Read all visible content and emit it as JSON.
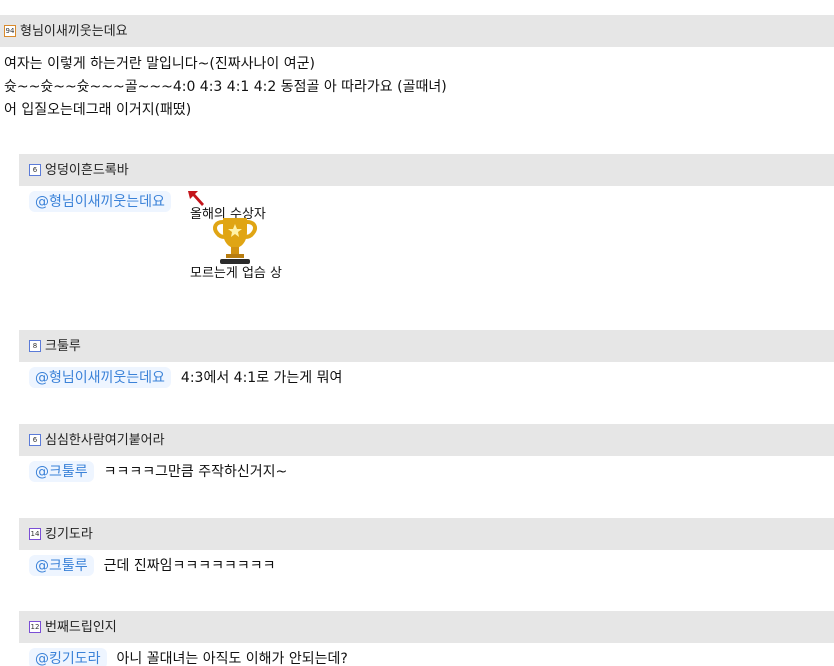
{
  "main_post": {
    "author": "형님이새끼웃는데요",
    "level": "94",
    "lines": [
      "여자는 이렇게 하는거란 말입니다~(진짜사나이 여군)",
      "슛~~슛~~슛~~~골~~~4:0 4:3 4:1 4:2 동점골 아 따라가요 (골때녀)",
      "어 입질오는데그래 이거지(패떴)"
    ]
  },
  "comments": [
    {
      "author": "엉덩이흔드록바",
      "level": "6",
      "mention": "@형님이새끼웃는데요",
      "text": "",
      "award": {
        "top": "올해의 수상자",
        "bottom": "모르는게 업슴 상"
      }
    },
    {
      "author": "크툴루",
      "level": "8",
      "mention": "@형님이새끼웃는데요",
      "text": "4:3에서 4:1로 가는게 뭐여"
    },
    {
      "author": "심심한사람여기붙어라",
      "level": "6",
      "mention": "@크툴루",
      "text": "ㅋㅋㅋㅋ그만큼 주작하신거지~"
    },
    {
      "author": "킹기도라",
      "level": "14",
      "mention": "@크툴루",
      "text": "근데 진짜임ㅋㅋㅋㅋㅋㅋㅋㅋ"
    },
    {
      "author": "번째드립인지",
      "level": "12",
      "mention": "@킹기도라",
      "text": "아니 꼴대녀는 아직도 이해가 안되는데?"
    }
  ],
  "colors": {
    "mention_bg": "#eef5ff",
    "mention_text": "#3b82d8",
    "header_bg": "#e6e6e6"
  },
  "icons": {
    "award_arrow": "arrow-up-left-icon",
    "trophy": "trophy-icon"
  }
}
